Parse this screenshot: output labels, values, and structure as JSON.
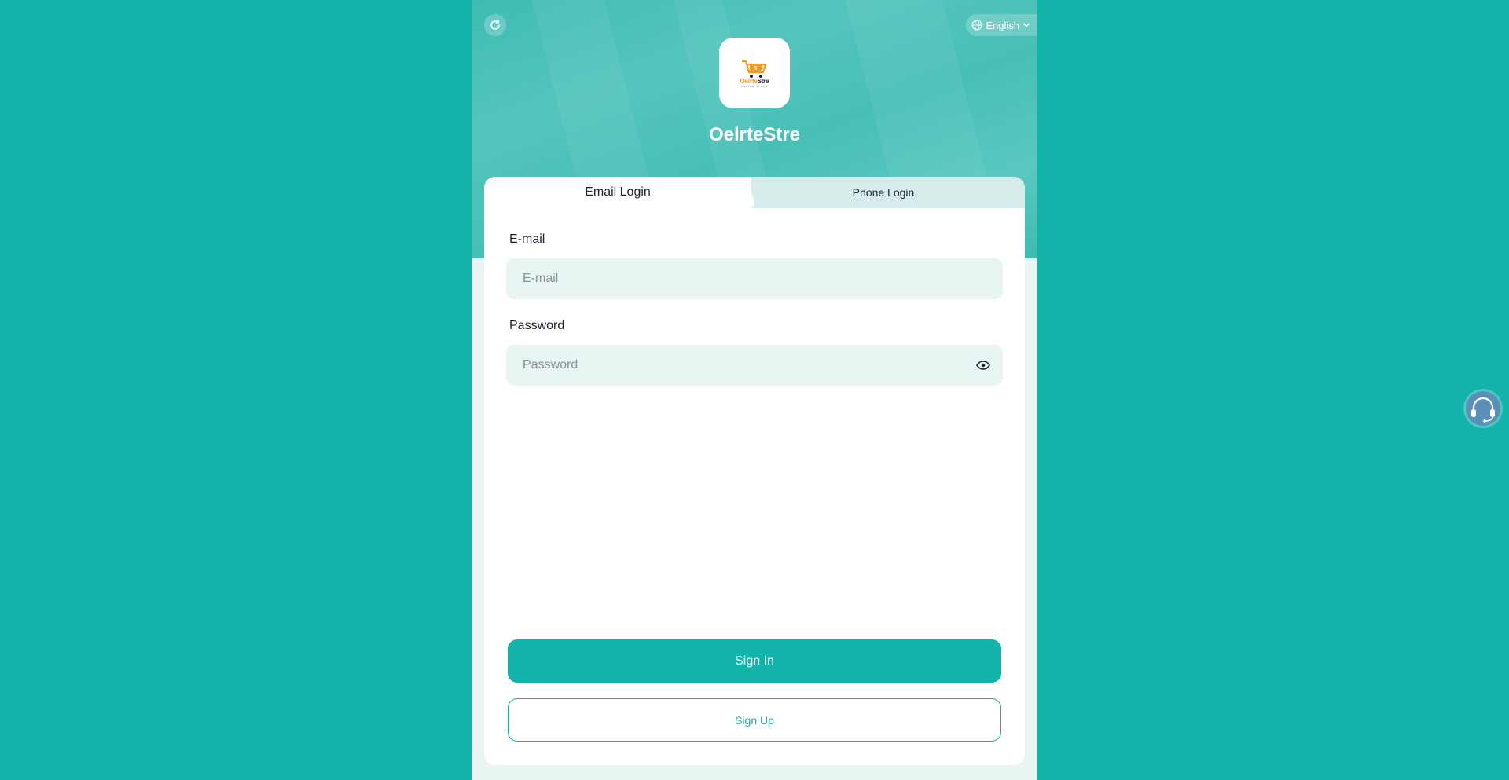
{
  "header": {
    "language": "English",
    "brand_name": "OelrteStre",
    "logo": {
      "word_a": "Oelrte",
      "word_b": "Stre",
      "tagline": "ONLINE STORE"
    }
  },
  "tabs": [
    {
      "label": "Email Login",
      "active": true
    },
    {
      "label": "Phone Login",
      "active": false
    }
  ],
  "form": {
    "email_label": "E-mail",
    "email_placeholder": "E-mail",
    "email_value": "",
    "password_label": "Password",
    "password_placeholder": "Password",
    "password_value": ""
  },
  "actions": {
    "sign_in": "Sign In",
    "sign_up": "Sign Up"
  },
  "icons": {
    "refresh": "refresh-icon",
    "language": "globe-icon",
    "dropdown": "chevron-down-icon",
    "show_password": "eye-icon",
    "support": "headset-icon",
    "logo": "shopping-cart-icon"
  },
  "colors": {
    "accent": "#14b3a9",
    "background": "#14b3a9",
    "input_bg": "#e8f5f3",
    "text": "#1d2330"
  }
}
